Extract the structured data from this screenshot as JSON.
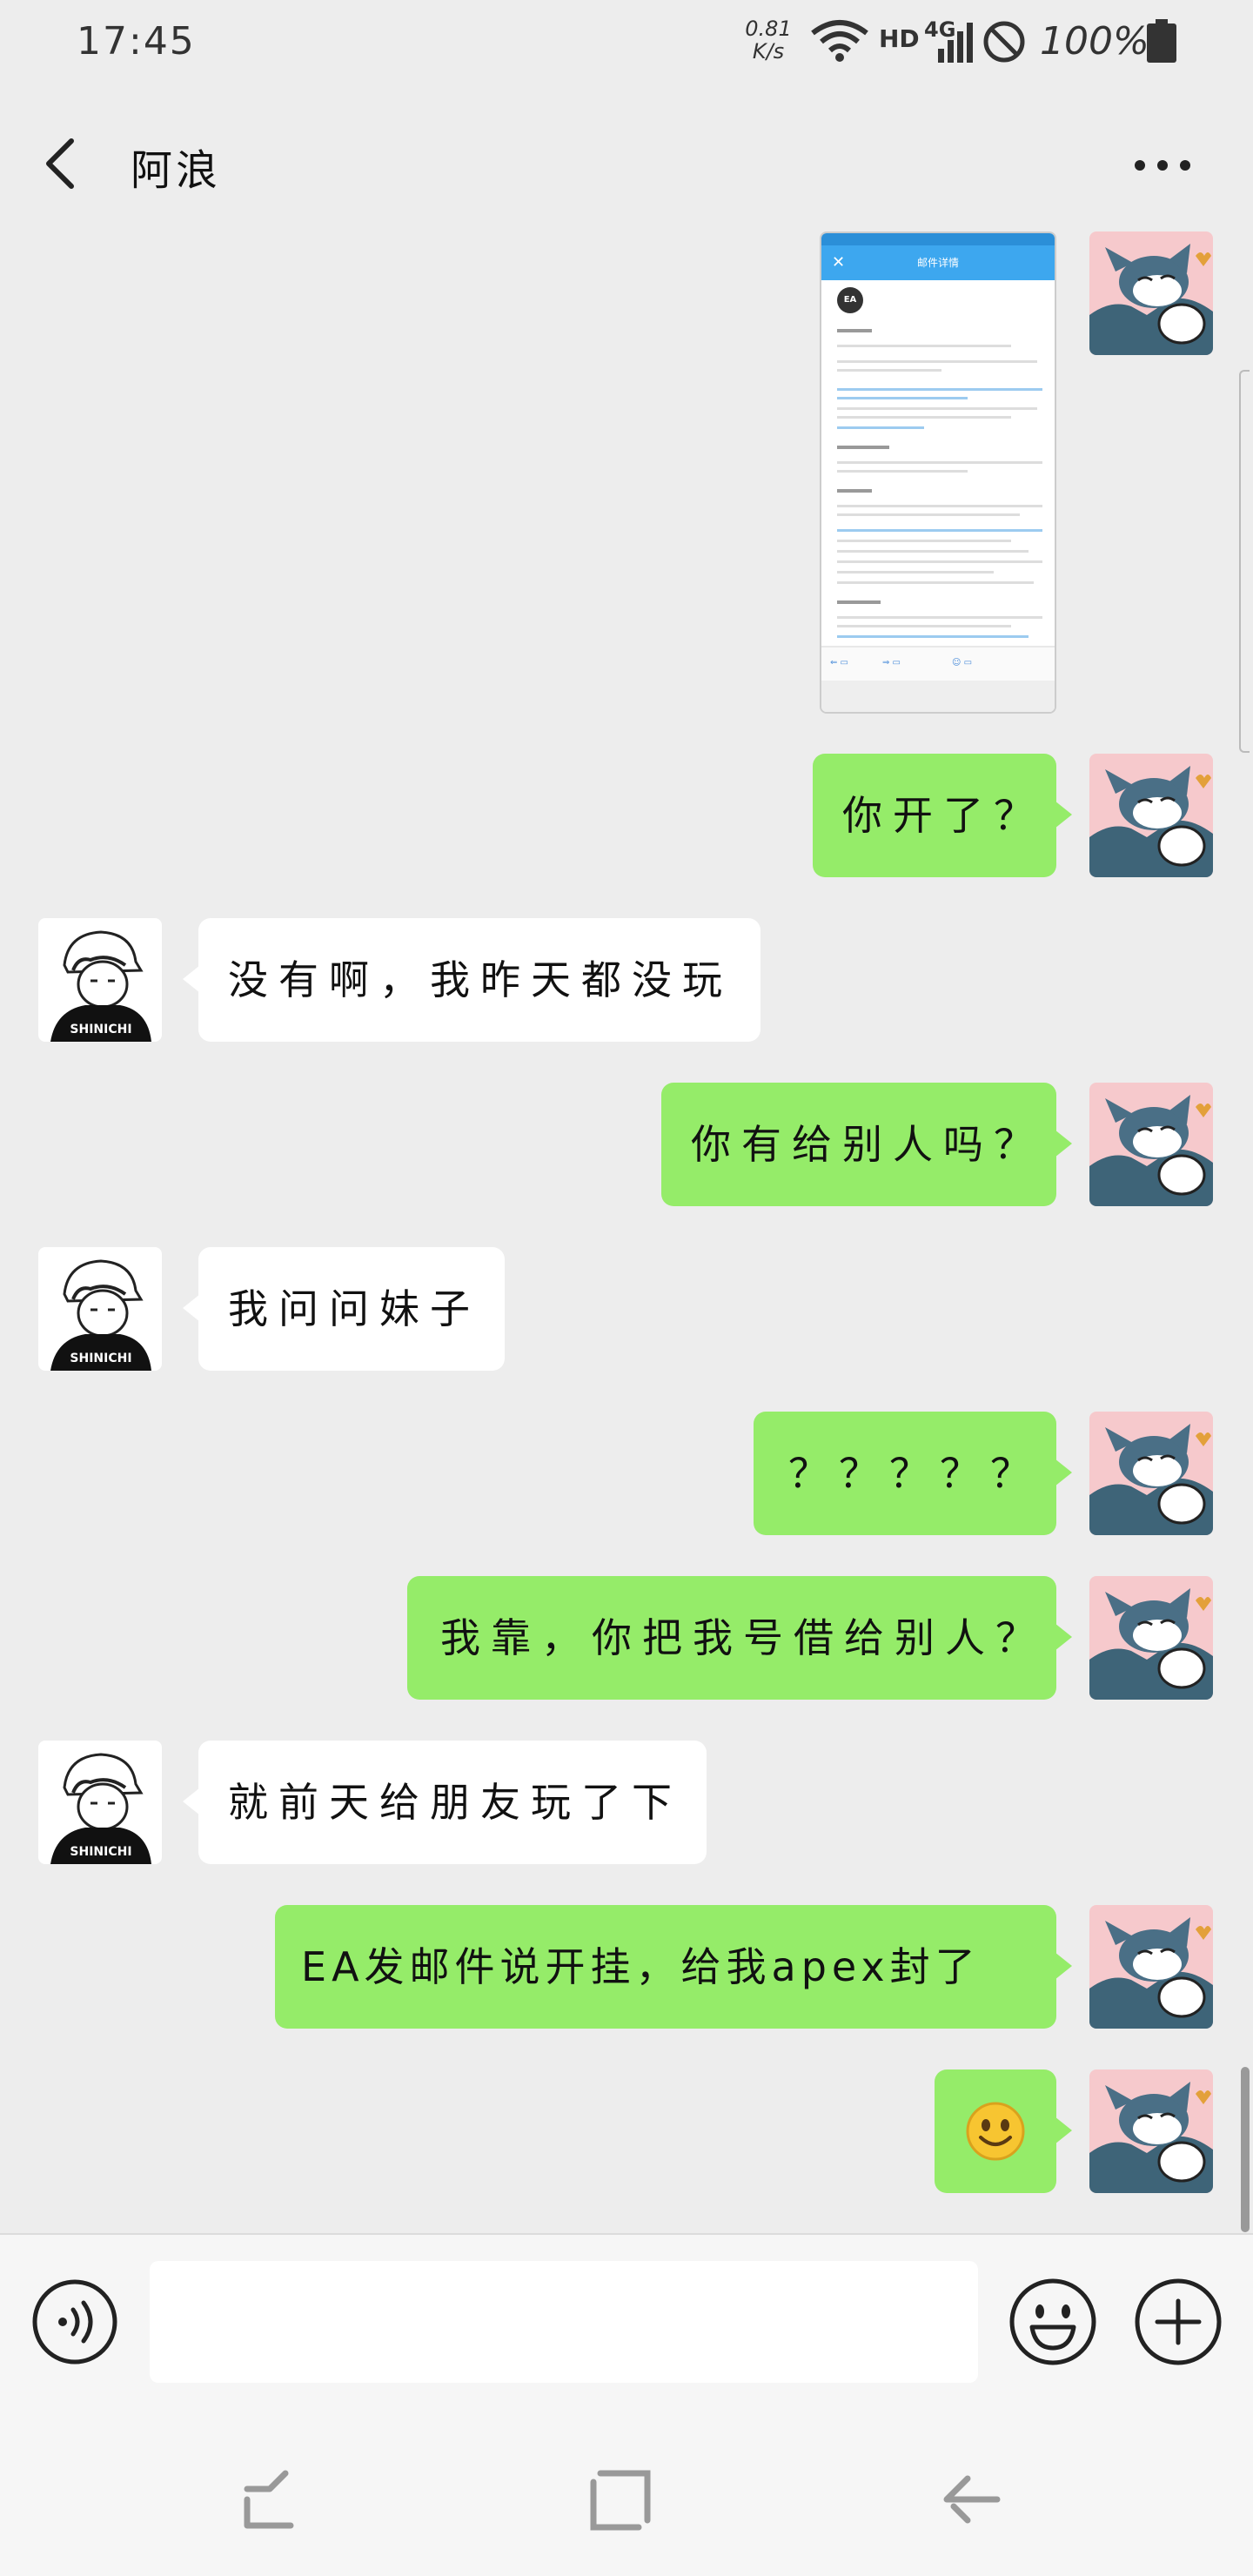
{
  "status_bar": {
    "time": "17:45",
    "speed_value": "0.81",
    "speed_unit": "K/s",
    "network_hd": "HD",
    "network_type": "4G",
    "battery": "100%"
  },
  "header": {
    "title": "阿浪",
    "back_icon": "chevron-left-icon",
    "more_icon": "more-dots-icon"
  },
  "screenshot_preview": {
    "brand": "EA",
    "header_title": "邮件详情"
  },
  "messages": [
    {
      "side": "right",
      "text": "你开了？"
    },
    {
      "side": "left",
      "text": "没有啊，我昨天都没玩"
    },
    {
      "side": "right",
      "text": "你有给别人吗？"
    },
    {
      "side": "left",
      "text": "我问问妹子"
    },
    {
      "side": "right",
      "text": "？？？？？"
    },
    {
      "side": "right",
      "text": "我靠，你把我号借给别人？"
    },
    {
      "side": "left",
      "text": "就前天给朋友玩了下"
    },
    {
      "side": "right",
      "text": "EA发邮件说开挂，给我apex封了"
    },
    {
      "side": "right",
      "emoji": "smile-emoji"
    }
  ],
  "input_bar": {
    "value": "",
    "voice_icon": "voice-icon",
    "emoji_icon": "emoji-icon",
    "plus_icon": "plus-icon"
  },
  "colors": {
    "own_bubble": "#95ec69",
    "other_bubble": "#ffffff",
    "background": "#ededed"
  }
}
